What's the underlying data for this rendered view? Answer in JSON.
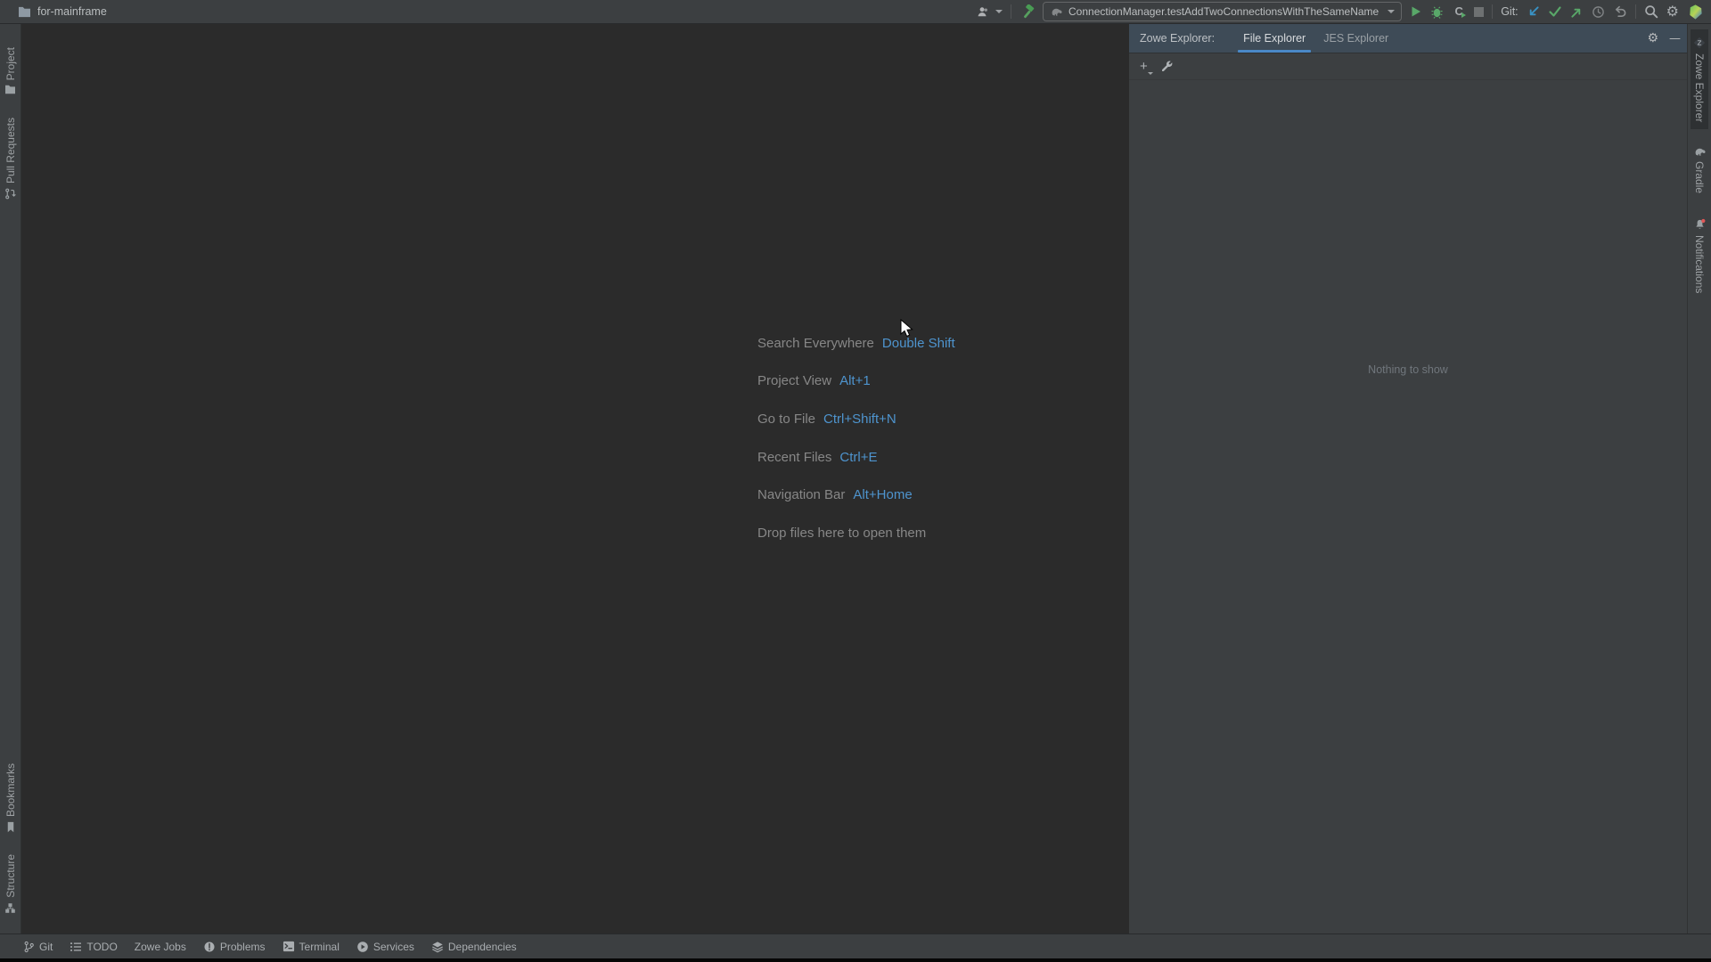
{
  "title_bar": {
    "project_name": "for-mainframe",
    "run_config": "ConnectionManager.testAddTwoConnectionsWithTheSameName",
    "git_label": "Git:"
  },
  "icons": {
    "plus": "+",
    "minus": "—",
    "gear": "⚙",
    "coverage_letter": "C",
    "zowe_letter": "Z"
  },
  "left_stripe": {
    "top": [
      {
        "label": "Project"
      },
      {
        "label": "Pull Requests"
      }
    ],
    "bottom": [
      {
        "label": "Bookmarks"
      },
      {
        "label": "Structure"
      }
    ]
  },
  "right_stripe": {
    "items": [
      {
        "label": "Zowe Explorer"
      },
      {
        "label": "Gradle"
      },
      {
        "label": "Notifications"
      }
    ]
  },
  "tool_window": {
    "title": "Zowe Explorer:",
    "tabs": [
      {
        "label": "File Explorer"
      },
      {
        "label": "JES Explorer"
      }
    ],
    "empty_text": "Nothing to show"
  },
  "editor": {
    "shortcuts": [
      {
        "label": "Search Everywhere",
        "keys": "Double Shift"
      },
      {
        "label": "Project View",
        "keys": "Alt+1"
      },
      {
        "label": "Go to File",
        "keys": "Ctrl+Shift+N"
      },
      {
        "label": "Recent Files",
        "keys": "Ctrl+E"
      },
      {
        "label": "Navigation Bar",
        "keys": "Alt+Home"
      }
    ],
    "drop_hint": "Drop files here to open them"
  },
  "status_bar": {
    "items": [
      {
        "label": "Git"
      },
      {
        "label": "TODO"
      },
      {
        "label": "Zowe Jobs"
      },
      {
        "label": "Problems"
      },
      {
        "label": "Terminal"
      },
      {
        "label": "Services"
      },
      {
        "label": "Dependencies"
      }
    ]
  },
  "colors": {
    "accent_blue": "#4e94ce",
    "tab_underline": "#4A88C7",
    "run_green": "#59A869",
    "git_update_blue": "#3992C4",
    "notification_red": "#E05757",
    "header_slate": "#3e4b57",
    "panel_bg": "#3c3f41",
    "editor_bg": "#2b2b2b"
  }
}
